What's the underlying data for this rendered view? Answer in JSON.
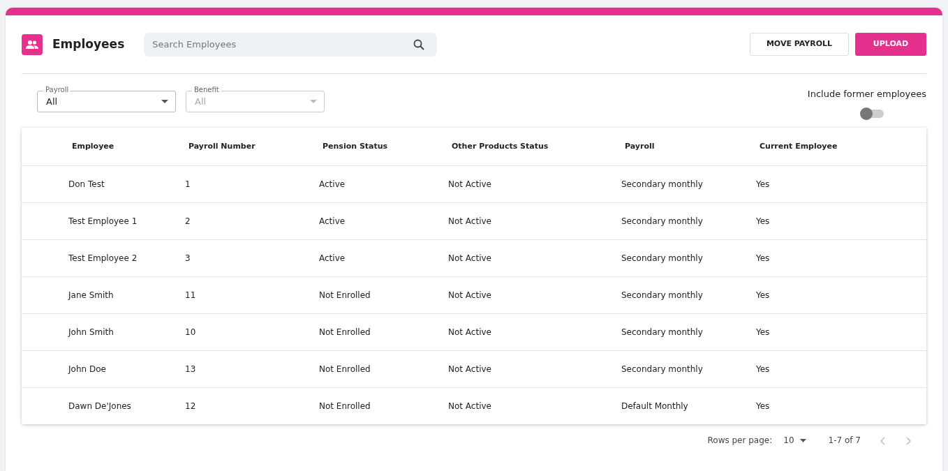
{
  "header": {
    "title": "Employees",
    "search": {
      "placeholder": "Search Employees"
    },
    "buttons": [
      {
        "label": "MOVE PAYROLL",
        "kind": "outline"
      },
      {
        "label": "UPLOAD",
        "kind": "primary"
      }
    ]
  },
  "filters": [
    {
      "label": "Payroll",
      "value": "All",
      "disabled": false
    },
    {
      "label": "Benefit",
      "value": "All",
      "disabled": true
    }
  ],
  "toggle": {
    "label": "Include former employees",
    "on": false
  },
  "table": {
    "columns": [
      "Employee",
      "Payroll Number",
      "Pension Status",
      "Other Products Status",
      "Payroll",
      "Current Employee"
    ],
    "rows": [
      [
        "Don Test",
        "1",
        "Active",
        "Not Active",
        "Secondary monthly",
        "Yes"
      ],
      [
        "Test Employee 1",
        "2",
        "Active",
        "Not Active",
        "Secondary monthly",
        "Yes"
      ],
      [
        "Test Employee 2",
        "3",
        "Active",
        "Not Active",
        "Secondary monthly",
        "Yes"
      ],
      [
        "Jane Smith",
        "11",
        "Not Enrolled",
        "Not Active",
        "Secondary monthly",
        "Yes"
      ],
      [
        "John Smith",
        "10",
        "Not Enrolled",
        "Not Active",
        "Secondary monthly",
        "Yes"
      ],
      [
        "John Doe",
        "13",
        "Not Enrolled",
        "Not Active",
        "Secondary monthly",
        "Yes"
      ],
      [
        "Dawn De'Jones",
        "12",
        "Not Enrolled",
        "Not Active",
        "Default Monthly",
        "Yes"
      ]
    ]
  },
  "pagination": {
    "rows_label": "Rows per page:",
    "rows_value": "10",
    "range": "1-7 of 7",
    "prev_disabled": true,
    "next_disabled": true
  }
}
